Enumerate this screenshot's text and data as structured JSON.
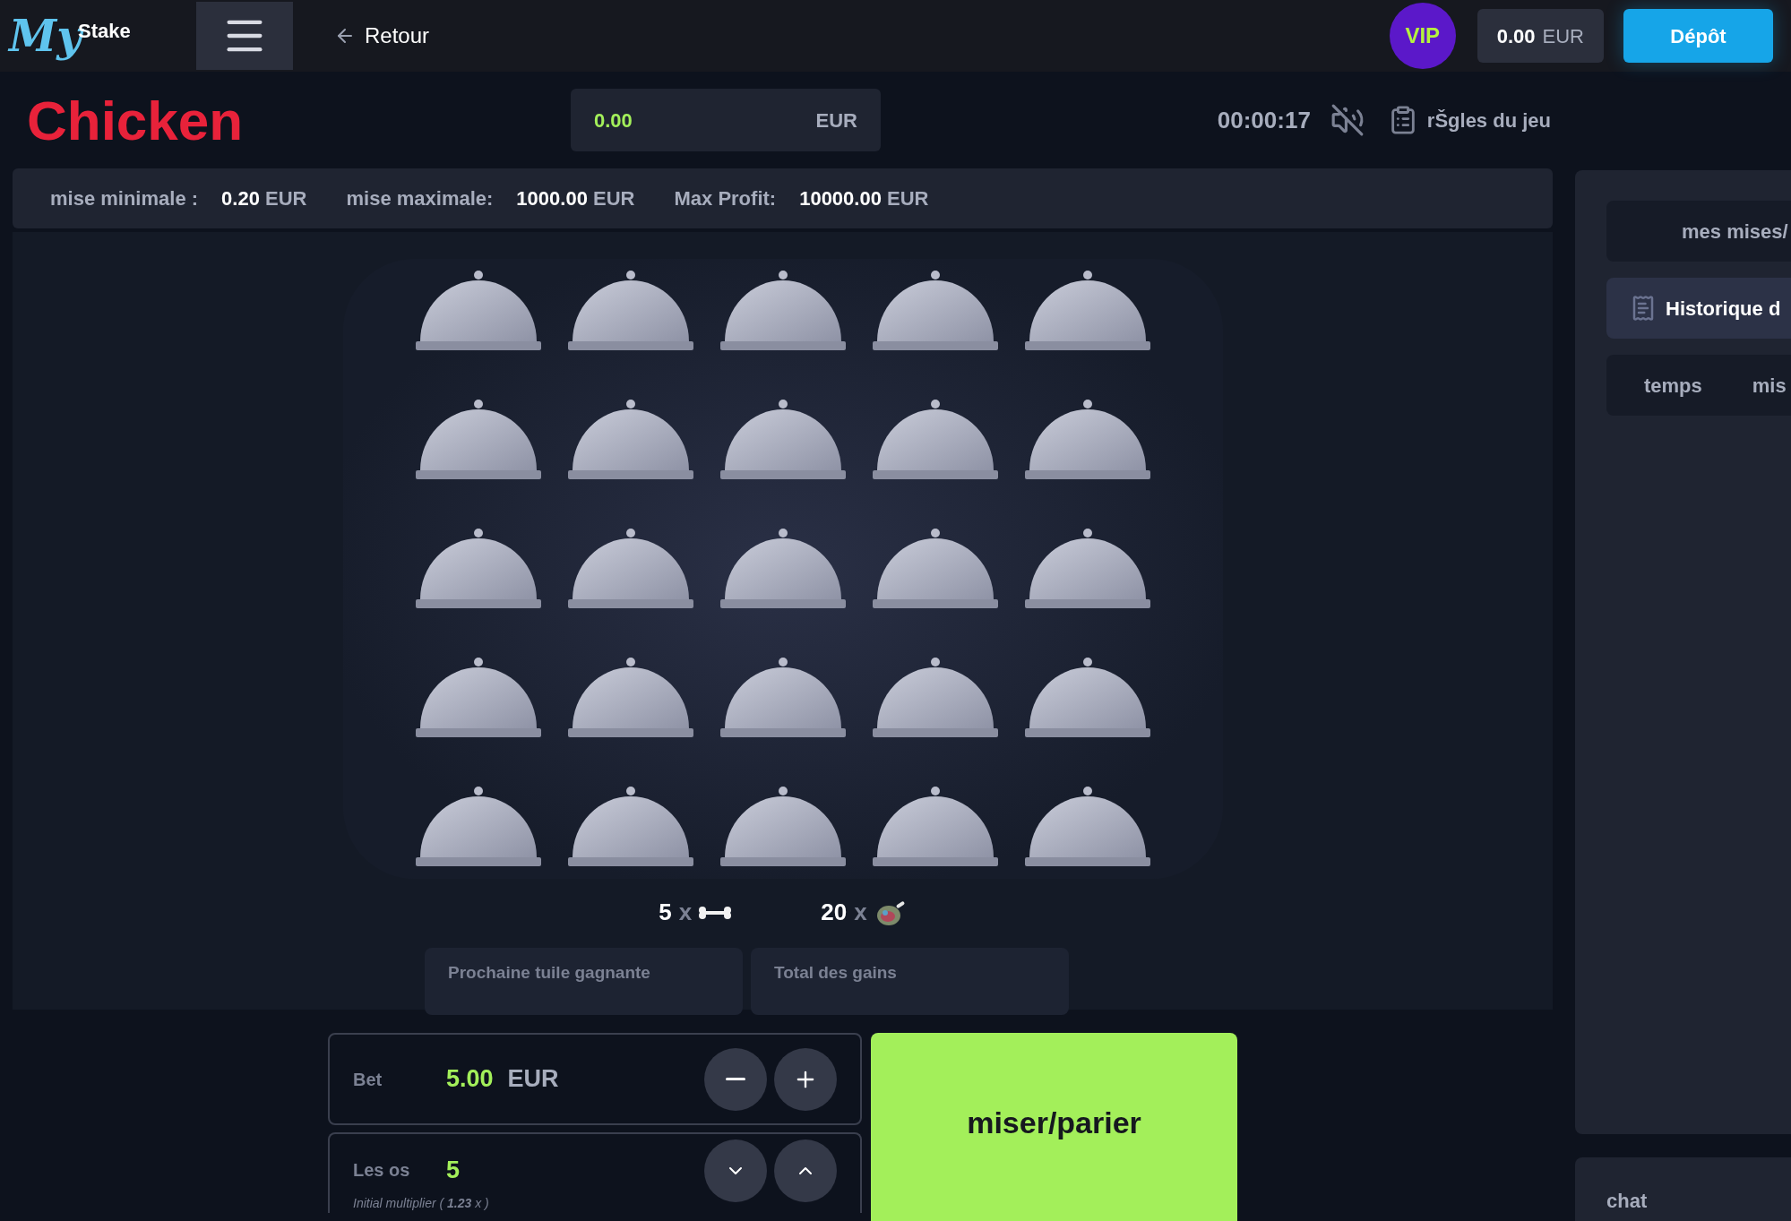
{
  "header": {
    "logo": {
      "script": "My",
      "text": "Stake"
    },
    "back": "Retour",
    "vip": "VIP",
    "balance": {
      "amount": "0.00",
      "currency": "EUR"
    },
    "deposit": "Dépôt"
  },
  "game": {
    "title": "Chicken",
    "win_field": {
      "amount": "0.00",
      "currency": "EUR"
    },
    "timer": "00:00:17",
    "sound": {
      "muted": true
    },
    "rules": "rŠgles du jeu"
  },
  "limits": [
    {
      "label": "mise minimale :",
      "value": "0.20",
      "currency": "EUR"
    },
    {
      "label": "mise maximale:",
      "value": "1000.00",
      "currency": "EUR"
    },
    {
      "label": "Max Profit:",
      "value": "10000.00",
      "currency": "EUR"
    }
  ],
  "tiles": [
    {
      "kind": "cover"
    },
    {
      "kind": "cover"
    },
    {
      "kind": "cover"
    },
    {
      "kind": "cover"
    },
    {
      "kind": "cover"
    },
    {
      "kind": "cover"
    },
    {
      "kind": "cover"
    },
    {
      "kind": "cover"
    },
    {
      "kind": "cover"
    },
    {
      "kind": "cover"
    },
    {
      "kind": "cover"
    },
    {
      "kind": "cover"
    },
    {
      "kind": "cover"
    },
    {
      "kind": "cover"
    },
    {
      "kind": "cover"
    },
    {
      "kind": "cover"
    },
    {
      "kind": "cover"
    },
    {
      "kind": "cover"
    },
    {
      "kind": "cover"
    },
    {
      "kind": "cover"
    },
    {
      "kind": "cover"
    },
    {
      "kind": "cover"
    },
    {
      "kind": "cover"
    },
    {
      "kind": "cover"
    },
    {
      "kind": "cover"
    }
  ],
  "counts": [
    {
      "kind": "bone",
      "count": "5",
      "x": "x"
    },
    {
      "kind": "chicken",
      "count": "20",
      "x": "x"
    }
  ],
  "result_boxes": [
    "Prochaine tuile gagnante",
    "Total des gains"
  ],
  "bet": {
    "label": "Bet",
    "amount": "5.00",
    "currency": "EUR"
  },
  "bones": {
    "label": "Les os",
    "value": "5",
    "note": "Initial multiplier ( **1.23** x )"
  },
  "play_button": "miser/parier",
  "side_panel": {
    "tabs": [
      {
        "label": "mes mises/",
        "selected": false,
        "kind": "plain"
      },
      {
        "label": "Historique d",
        "selected": true,
        "kind": "icon"
      }
    ],
    "columns": [
      "temps",
      "mis"
    ]
  },
  "chat": {
    "title": "chat"
  }
}
